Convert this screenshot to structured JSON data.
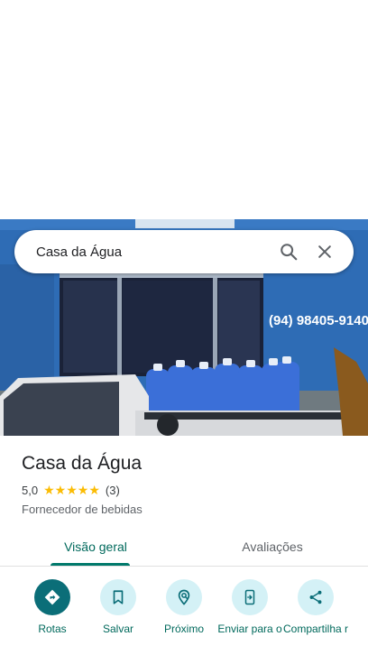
{
  "search": {
    "query": "Casa da Água"
  },
  "photo": {
    "sign_text": "(94) 98405-9140"
  },
  "place": {
    "name": "Casa da Água",
    "rating": "5,0",
    "stars": 5,
    "review_count": "(3)",
    "category": "Fornecedor de bebidas"
  },
  "tabs": [
    {
      "label": "Visão geral",
      "active": true
    },
    {
      "label": "Avaliações",
      "active": false
    }
  ],
  "actions": [
    {
      "label": "Rotas",
      "icon": "directions-icon"
    },
    {
      "label": "Salvar",
      "icon": "bookmark-icon"
    },
    {
      "label": "Próximo",
      "icon": "nearby-icon"
    },
    {
      "label": "Enviar para o",
      "icon": "send-to-phone-icon"
    },
    {
      "label": "Compartilha r",
      "icon": "share-icon"
    }
  ],
  "colors": {
    "accent": "#00695c",
    "primary_button": "#0b6e78",
    "action_bg": "#d4f1f6",
    "star": "#fbbc04"
  }
}
